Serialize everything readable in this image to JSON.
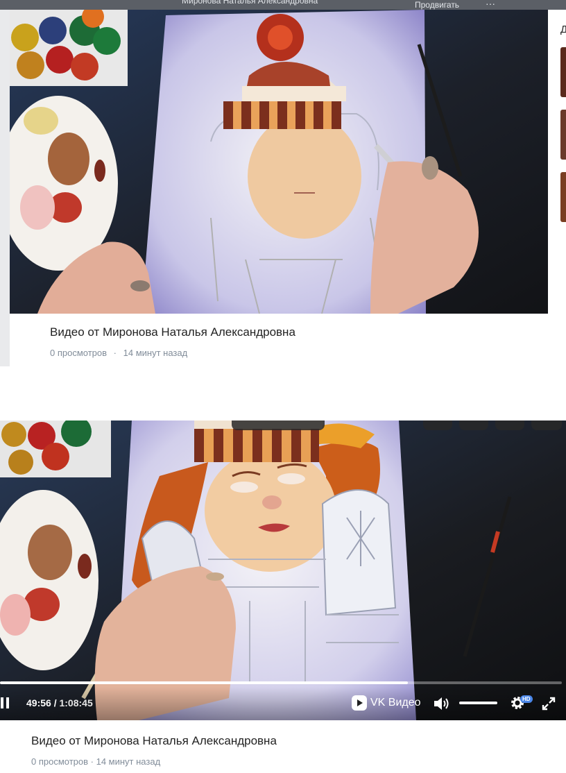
{
  "video1": {
    "title": "Видео от Миронова Наталья Александровна",
    "views": "0 просмотров",
    "separator": "·",
    "time_ago": "14 минут назад",
    "author_partial": "Миронова Наталья Александровна",
    "promote_label": "Продвигать",
    "more_label": "···",
    "sidebar_label": "Д"
  },
  "video2": {
    "title": "Видео от Миронова Наталья Александровна",
    "meta_partial": "0 просмотров · 14 минут назад",
    "player": {
      "current_time": "49:56",
      "time_separator": "/",
      "duration": "1:08:45",
      "progress": 0.726,
      "brand": "VK Видео",
      "hd_badge": "HD",
      "volume_level": 1.0
    }
  }
}
